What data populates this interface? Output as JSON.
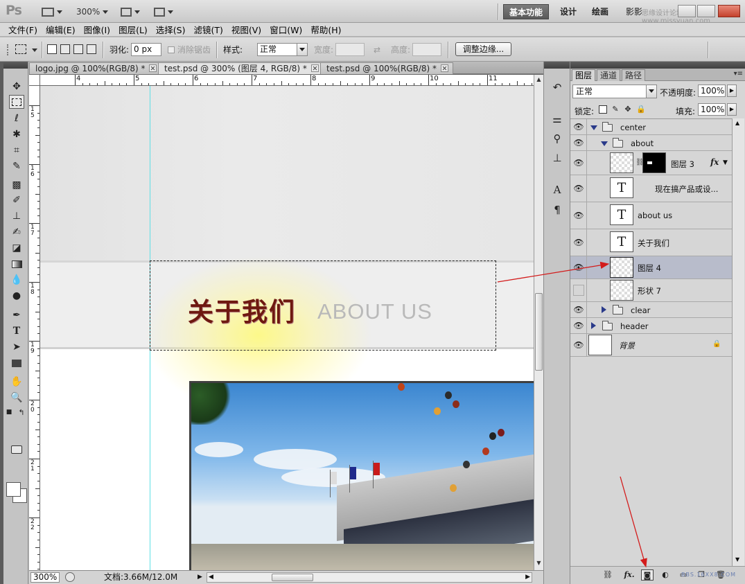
{
  "app": {
    "logo": "Ps",
    "zoom": "300%",
    "workspaces": [
      "基本功能",
      "设计",
      "绘画"
    ],
    "workspace_more": "影影",
    "watermark": "思缘设计论坛 www.missyuan.com"
  },
  "menu": [
    "文件(F)",
    "编辑(E)",
    "图像(I)",
    "图层(L)",
    "选择(S)",
    "滤镜(T)",
    "视图(V)",
    "窗口(W)",
    "帮助(H)"
  ],
  "options": {
    "feather_label": "羽化:",
    "feather_value": "0 px",
    "antialias_label": "消除锯齿",
    "style_label": "样式:",
    "style_value": "正常",
    "width_label": "宽度:",
    "height_label": "高度:",
    "refine_edge": "调整边缘..."
  },
  "tabs": [
    {
      "label": "logo.jpg @ 100%(RGB/8) *",
      "active": false
    },
    {
      "label": "test.psd @ 300% (图层 4, RGB/8) *",
      "active": true
    },
    {
      "label": "test.psd @ 100%(RGB/8) *",
      "active": false
    }
  ],
  "rulers": {
    "h": [
      "4",
      "5",
      "6",
      "7",
      "8",
      "9",
      "10",
      "11"
    ],
    "v": [
      "15",
      "16",
      "17",
      "18",
      "19",
      "20",
      "21",
      "22"
    ]
  },
  "canvas": {
    "heading_cn": "关于我们",
    "heading_en": "ABOUT US",
    "heading_color": "#6e1810",
    "guide_color": "#5fe0e6"
  },
  "status": {
    "zoom": "300%",
    "doc_info": "文档:3.66M/12.0M"
  },
  "layers_panel": {
    "tabs": [
      "图层",
      "通道",
      "路径"
    ],
    "blend_mode": "正常",
    "opacity_label": "不透明度:",
    "opacity_value": "100%",
    "lock_label": "锁定:",
    "fill_label": "填充:",
    "fill_value": "100%",
    "rows": [
      {
        "name": "center",
        "kind": "group",
        "expanded": true,
        "visible": true
      },
      {
        "name": "about",
        "kind": "group",
        "expanded": true,
        "visible": true
      },
      {
        "name": "图层 3",
        "kind": "masked",
        "visible": true,
        "fx": "fx"
      },
      {
        "name": "现在搞产品或设...",
        "kind": "text",
        "visible": true
      },
      {
        "name": "about us",
        "kind": "text",
        "visible": true
      },
      {
        "name": "关于我们",
        "kind": "text",
        "visible": true
      },
      {
        "name": "图层 4",
        "kind": "pixel",
        "visible": true,
        "selected": true
      },
      {
        "name": "形状 7",
        "kind": "pixel",
        "visible": false
      },
      {
        "name": "clear",
        "kind": "group",
        "expanded": false,
        "visible": true
      },
      {
        "name": "header",
        "kind": "group",
        "expanded": false,
        "visible": true
      },
      {
        "name": "背景",
        "kind": "background",
        "visible": true,
        "locked": true
      }
    ],
    "footer_watermark": "BBS.16XX8.COM"
  },
  "colors": {
    "accent_arrow": "#d31b1b",
    "selected_row": "#b8bccb"
  }
}
